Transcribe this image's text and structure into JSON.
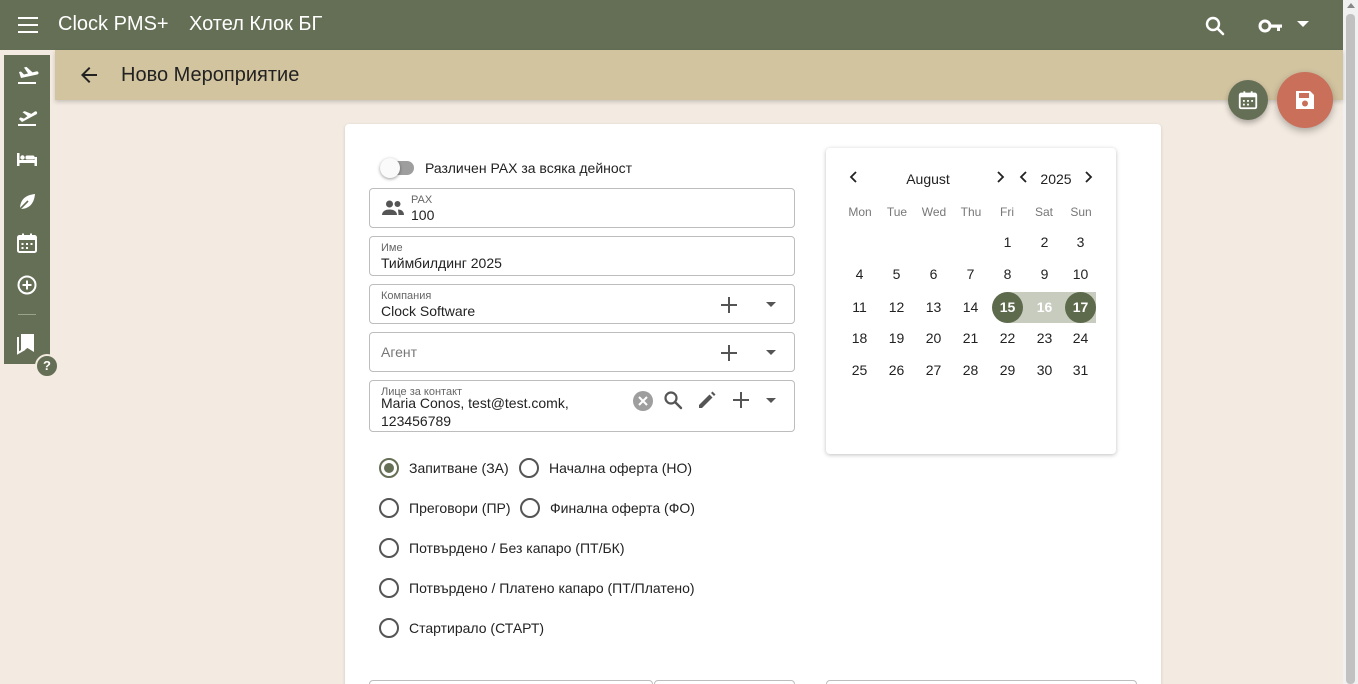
{
  "topbar": {
    "app_title": "Clock PMS+",
    "hotel_title": "Хотел Клок БГ",
    "icons": [
      "menu-icon",
      "search-icon",
      "key-icon",
      "chevron-down-icon"
    ],
    "color": "#656f55"
  },
  "sidebar": {
    "items": [
      {
        "icon": "arrivals-icon"
      },
      {
        "icon": "departures-icon"
      },
      {
        "icon": "bed-icon"
      },
      {
        "icon": "leaf-icon"
      },
      {
        "icon": "calendar-icon"
      },
      {
        "icon": "add-circle-icon"
      },
      {
        "icon": "bookmarks-icon"
      }
    ],
    "help_label": "?"
  },
  "pagebar": {
    "title": "Ново Мероприятие",
    "color": "#d3c4a0"
  },
  "actions": {
    "calendar_fab_icon": "calendar-icon",
    "save_fab_icon": "save-icon",
    "save_color": "#c96f5a"
  },
  "form": {
    "toggle_label": "Различен PAX за всяка дейност",
    "toggle_on": false,
    "pax": {
      "label": "PAX",
      "value": "100",
      "icon": "people-icon"
    },
    "name": {
      "label": "Име",
      "value": "Тиймбилдинг 2025"
    },
    "company": {
      "label": "Компания",
      "value": "Clock Software"
    },
    "agent": {
      "placeholder": "Агент"
    },
    "contact": {
      "label": "Лице за контакт",
      "value_line1": "Maria Conos, test@test.comk,",
      "value_line2": "123456789"
    },
    "statuses": [
      {
        "label": "Запитване (ЗА)",
        "checked": true
      },
      {
        "label": "Начална оферта (НО)",
        "checked": false
      },
      {
        "label": "Преговори (ПР)",
        "checked": false
      },
      {
        "label": "Финална оферта (ФО)",
        "checked": false
      },
      {
        "label": "Потвърдено / Без капаро (ПТ/БК)",
        "checked": false
      },
      {
        "label": "Потвърдено / Платено капаро (ПТ/Платено)",
        "checked": false
      },
      {
        "label": "Стартирало (СТАРТ)",
        "checked": false
      }
    ]
  },
  "calendar": {
    "month": "August",
    "year": "2025",
    "weekdays": [
      "Mon",
      "Tue",
      "Wed",
      "Thu",
      "Fri",
      "Sat",
      "Sun"
    ],
    "days": [
      "1",
      "2",
      "3",
      "4",
      "5",
      "6",
      "7",
      "8",
      "9",
      "10",
      "11",
      "12",
      "13",
      "14",
      "15",
      "16",
      "17",
      "18",
      "19",
      "20",
      "21",
      "22",
      "23",
      "24",
      "25",
      "26",
      "27",
      "28",
      "29",
      "30",
      "31"
    ],
    "range_start": "15",
    "range_mid": "16",
    "range_end": "17",
    "selected_color": "#5d6a4c"
  }
}
